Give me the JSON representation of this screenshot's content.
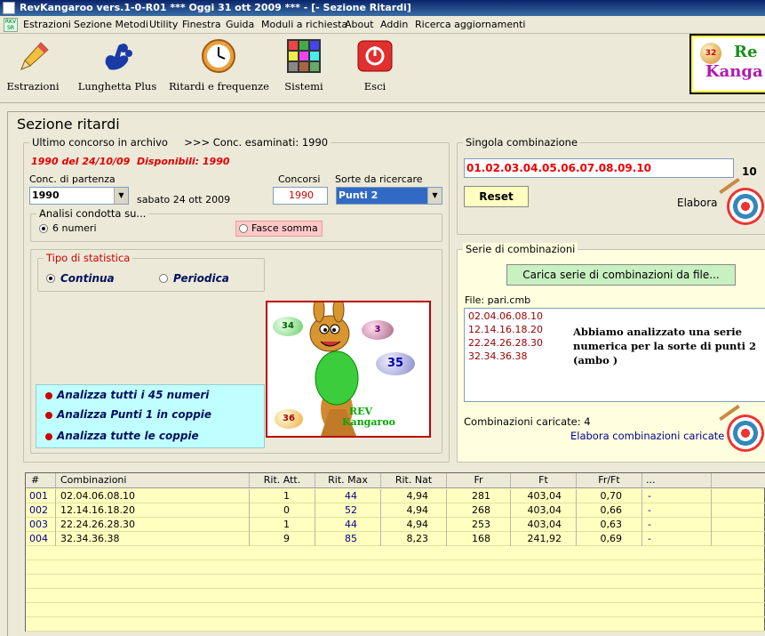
{
  "window": {
    "title": "RevKangaroo vers.1-0-R01  ***  Oggi 31 ott 2009  ***   - [- Sezione Ritardi]"
  },
  "menu": [
    "Estrazioni",
    "Sezione Metodi",
    "Utility",
    "Finestra",
    "Guida",
    "Moduli a richiesta",
    "About",
    "Addin",
    "Ricerca aggiornamenti"
  ],
  "toolbar": {
    "estrazioni": "Estrazioni",
    "lunghetta": "Lunghetta Plus",
    "ritardi": "Ritardi e frequenze",
    "sistemi": "Sistemi",
    "esci": "Esci"
  },
  "logo": {
    "ball": "32",
    "line1": "Re",
    "line2": "Kanga"
  },
  "section_title": "Sezione ritardi",
  "archive": {
    "legend": "Ultimo concorso in archivo",
    "examined": ">>> Conc. esaminati: 1990",
    "last": "1990 del 24/10/09",
    "available": "Disponibili: 1990"
  },
  "conc_partenza": {
    "label": "Conc. di partenza",
    "value": "1990",
    "date": "sabato 24 ott 2009"
  },
  "concorsi": {
    "label": "Concorsi",
    "value": "1990"
  },
  "sorte": {
    "label": "Sorte da ricercare",
    "value": "Punti 2"
  },
  "analisi": {
    "legend": "Analisi condotta su...",
    "opt1": "6 numeri",
    "opt2": "Fasce somma"
  },
  "tipo": {
    "legend": "Tipo di statistica",
    "opt1": "Continua",
    "opt2": "Periodica"
  },
  "analizza": [
    "Analizza tutti i 45 numeri",
    "Analizza Punti 1 in coppie",
    "Analizza tutte le coppie"
  ],
  "kangaroo": {
    "balls": [
      "34",
      "3",
      "35",
      "36"
    ],
    "text1": "REV",
    "text2": "Kangaroo"
  },
  "singola": {
    "legend": "Singola combinazione",
    "value": "01.02.03.04.05.06.07.08.09.10",
    "count": "10",
    "reset": "Reset",
    "elabora": "Elabora"
  },
  "serie": {
    "legend": "Serie di combinazioni",
    "load_btn": "Carica serie di combinazioni da file...",
    "file": "File: pari.cmb",
    "items": [
      "02.04.06.08.10",
      "12.14.16.18.20",
      "22.24.26.28.30",
      "32.34.36.38"
    ],
    "note": "Abbiamo analizzato una serie numerica per la sorte di punti 2 (ambo )",
    "caricate": "Combinazioni caricate: 4",
    "elabora": "Elabora combinazioni caricate"
  },
  "table": {
    "headers": [
      "#",
      "Combinazioni",
      "Rit. Att.",
      "Rit. Max",
      "Rit. Nat",
      "Fr",
      "Ft",
      "Fr/Ft",
      "..."
    ],
    "rows": [
      [
        "001",
        "02.04.06.08.10",
        "1",
        "44",
        "4,94",
        "281",
        "403,04",
        "0,70",
        "-"
      ],
      [
        "002",
        "12.14.16.18.20",
        "0",
        "52",
        "4,94",
        "268",
        "403,04",
        "0,66",
        "-"
      ],
      [
        "003",
        "22.24.26.28.30",
        "1",
        "44",
        "4,94",
        "253",
        "403,04",
        "0,63",
        "-"
      ],
      [
        "004",
        "32.34.36.38",
        "9",
        "85",
        "8,23",
        "168",
        "241,92",
        "0,69",
        "-"
      ]
    ]
  }
}
